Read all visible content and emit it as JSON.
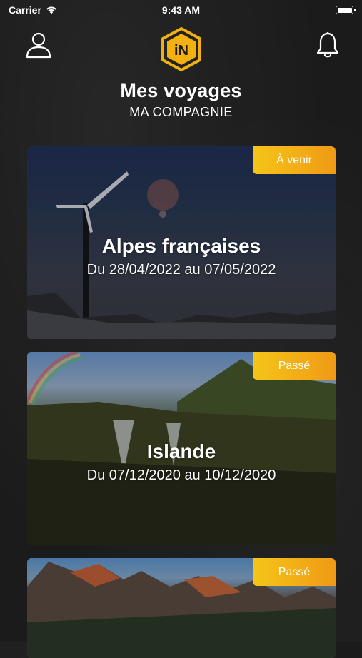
{
  "status_bar": {
    "carrier": "Carrier",
    "time": "9:43 AM"
  },
  "header": {
    "logo_text": "iN",
    "profile_icon": "user-icon",
    "notifications_icon": "bell-icon"
  },
  "page": {
    "title": "Mes voyages",
    "subtitle": "MA COMPAGNIE"
  },
  "trips": [
    {
      "title": "Alpes françaises",
      "dates": "Du 28/04/2022 au 07/05/2022",
      "status": "À venir"
    },
    {
      "title": "Islande",
      "dates": "Du 07/12/2020 au 10/12/2020",
      "status": "Passé"
    },
    {
      "title": "",
      "dates": "",
      "status": "Passé"
    }
  ],
  "colors": {
    "accent_start": "#f5c518",
    "accent_end": "#f09a16",
    "background": "#1b1b1b"
  }
}
